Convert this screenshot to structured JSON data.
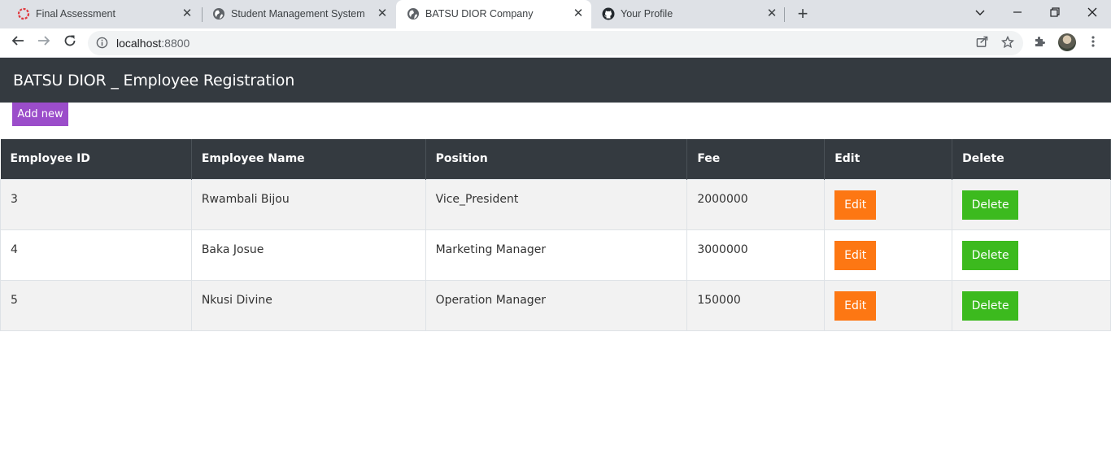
{
  "browser": {
    "tabs": [
      {
        "title": "Final Assessment",
        "icon": "ring-favicon-icon",
        "active": false
      },
      {
        "title": "Student Management System",
        "icon": "globe-icon",
        "active": false
      },
      {
        "title": "BATSU DIOR Company",
        "icon": "globe-icon",
        "active": true
      },
      {
        "title": "Your Profile",
        "icon": "github-icon",
        "active": false
      }
    ],
    "url_host": "localhost",
    "url_port": ":8800"
  },
  "app": {
    "title": "BATSU DIOR _ Employee Registration",
    "add_new_label": "Add new"
  },
  "table": {
    "headers": [
      "Employee ID",
      "Employee Name",
      "Position",
      "Fee",
      "Edit",
      "Delete"
    ],
    "rows": [
      {
        "id": "3",
        "name": "Rwambali Bijou",
        "position": "Vice_President",
        "fee": "2000000",
        "edit": "Edit",
        "delete": "Delete"
      },
      {
        "id": "4",
        "name": "Baka Josue",
        "position": "Marketing Manager",
        "fee": "3000000",
        "edit": "Edit",
        "delete": "Delete"
      },
      {
        "id": "5",
        "name": "Nkusi Divine",
        "position": "Operation Manager",
        "fee": "150000",
        "edit": "Edit",
        "delete": "Delete"
      }
    ]
  },
  "colors": {
    "header_bg": "#343a40",
    "add_new_bg": "#9b4dca",
    "edit_bg": "#fd7713",
    "delete_bg": "#3cba1e"
  }
}
